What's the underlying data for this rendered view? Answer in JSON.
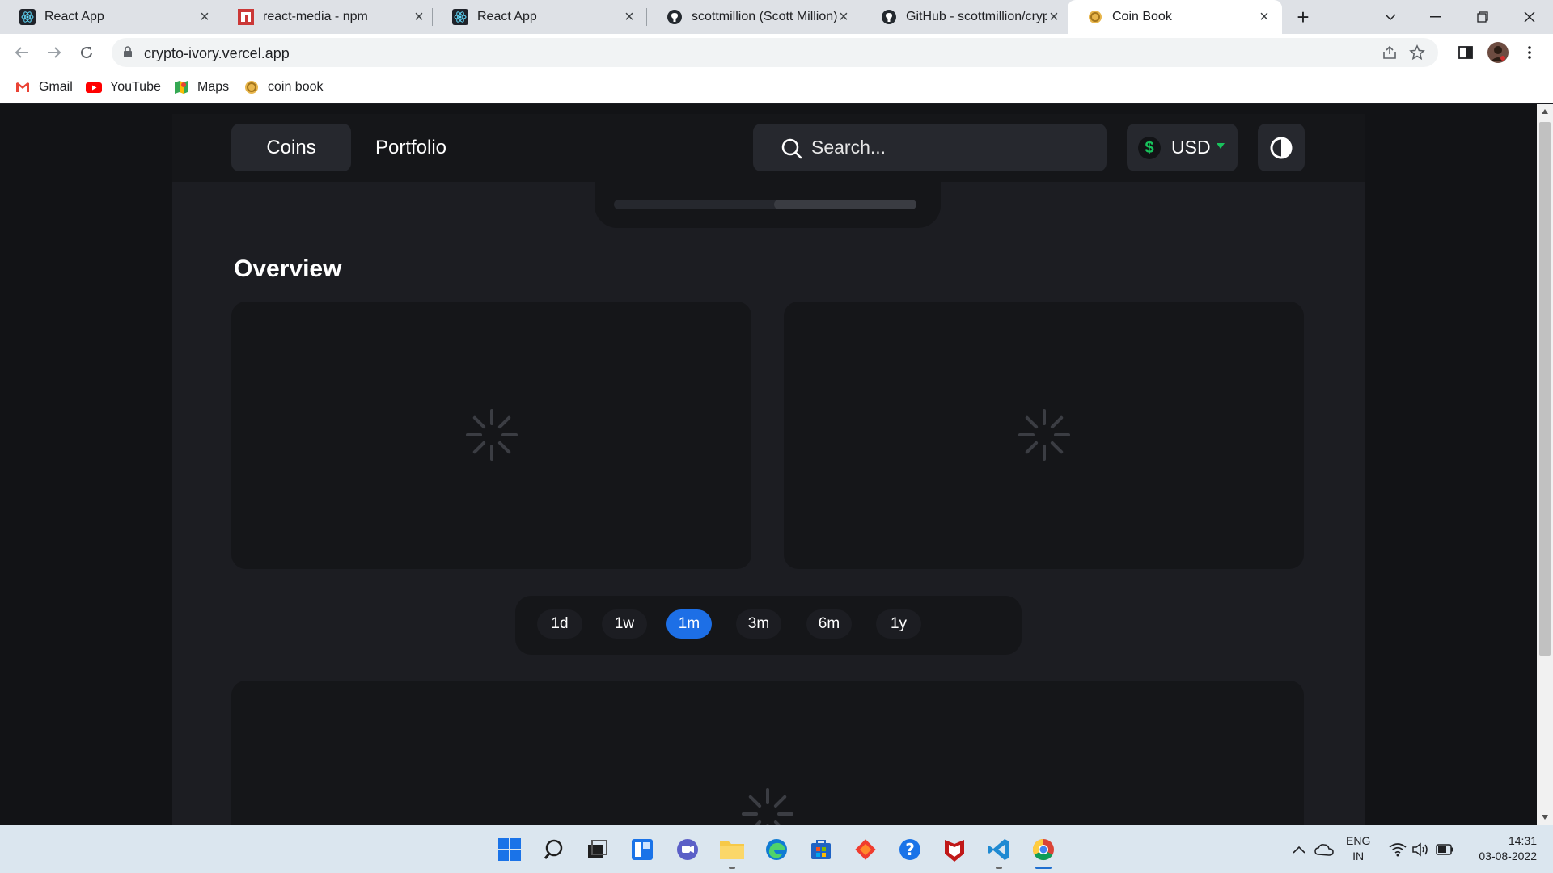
{
  "browser": {
    "tabs": [
      {
        "title": "React App",
        "icon": "react-icon"
      },
      {
        "title": "react-media - npm",
        "icon": "npm-icon"
      },
      {
        "title": "React App",
        "icon": "react-icon"
      },
      {
        "title": "scottmillion (Scott Million) · G",
        "icon": "github-icon"
      },
      {
        "title": "GitHub - scottmillion/crypto",
        "icon": "github-icon"
      },
      {
        "title": "Coin Book",
        "icon": "coin-icon",
        "active": true
      }
    ],
    "url": "crypto-ivory.vercel.app",
    "bookmarks": [
      {
        "label": "Gmail",
        "icon": "gmail-icon"
      },
      {
        "label": "YouTube",
        "icon": "youtube-icon"
      },
      {
        "label": "Maps",
        "icon": "maps-icon"
      },
      {
        "label": "coin book",
        "icon": "coin-icon"
      }
    ]
  },
  "app": {
    "nav": {
      "coins": "Coins",
      "portfolio": "Portfolio"
    },
    "search": {
      "placeholder": "Search..."
    },
    "currency": {
      "symbol": "$",
      "code": "USD"
    },
    "ticker_progress": 0.47,
    "overview_title": "Overview",
    "ranges": [
      "1d",
      "1w",
      "1m",
      "3m",
      "6m",
      "1y"
    ],
    "selected_range": "1m",
    "colors": {
      "accent": "#1d6fe6",
      "positive": "#18c35c",
      "background": "#1c1d22",
      "card": "#151619"
    }
  },
  "taskbar": {
    "apps": [
      "windows-start-icon",
      "search-icon",
      "task-view-icon",
      "widgets-icon",
      "teams-chat-icon",
      "file-explorer-icon",
      "edge-icon",
      "store-icon",
      "git-icon",
      "help-icon",
      "mcafee-icon",
      "vscode-icon",
      "chrome-icon"
    ],
    "lang_line1": "ENG",
    "lang_line2": "IN",
    "time": "14:31",
    "date": "03-08-2022"
  }
}
